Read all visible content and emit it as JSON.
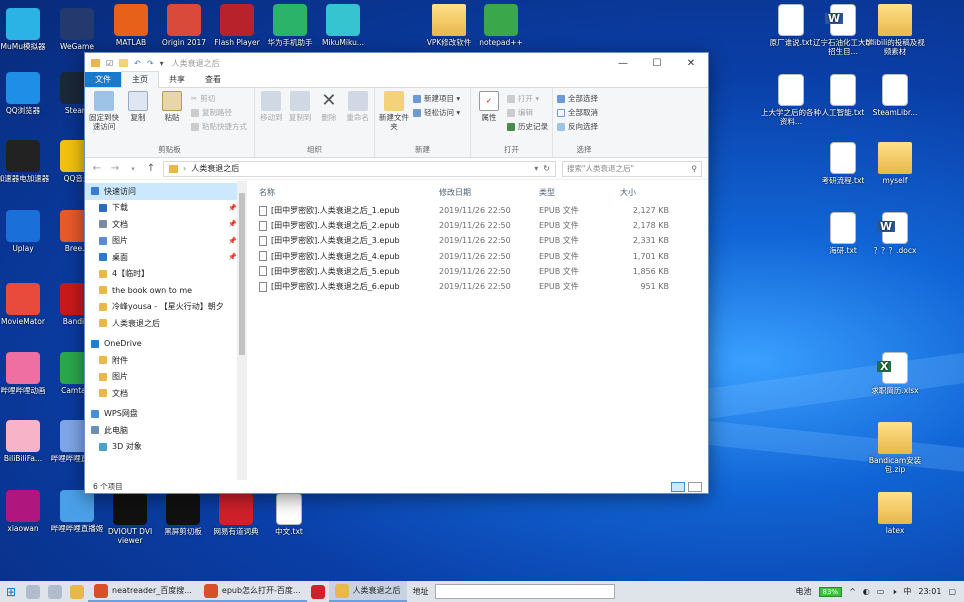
{
  "desktop": {
    "left_col1": [
      "MuMu模拟器",
      "QQ浏览器",
      "加速器电加速器",
      "Uplay",
      "MovieMator",
      "哔哩哔哩动画",
      "BiliBiliFa...",
      "xiaowan"
    ],
    "left_col2": [
      "WeGame",
      "Steam",
      "QQ音乐",
      "Bree...",
      "Bandi...",
      "Camta...",
      "哔哩哔哩直播姬",
      "哔哩哔哩直播姬"
    ],
    "top_row": [
      "MATLAB",
      "Origin 2017",
      "Flash Player",
      "华为手机助手",
      "MikuMiku..."
    ],
    "top_right_files": [
      "VPK修改软件",
      "notepad++"
    ],
    "bottom_row": [
      "DVIOUT DVI viewer",
      "黑屏剪切板",
      "网易有道词典",
      "中文.txt"
    ],
    "right_col": [
      {
        "label": "原厂谁说.txt",
        "kind": "file"
      },
      {
        "label": "辽宁石油化工大学招生目...",
        "kind": "word"
      },
      {
        "label": "bilibili的投稿及视频素材",
        "kind": "folder"
      },
      {
        "label": "上大学之后的各种资料...",
        "kind": "file"
      },
      {
        "label": "人工智能.txt",
        "kind": "file"
      },
      {
        "label": "SteamLibr...",
        "kind": "file"
      },
      {
        "label": "考研流程.txt",
        "kind": "file"
      },
      {
        "label": "myself",
        "kind": "folder"
      },
      {
        "label": "海研.txt",
        "kind": "file"
      },
      {
        "label": "？？？.docx",
        "kind": "word"
      },
      {
        "label": "求职简历.xlsx",
        "kind": "excel"
      },
      {
        "label": "Bandicam安装包.zip",
        "kind": "folder"
      },
      {
        "label": "latex",
        "kind": "folder"
      }
    ]
  },
  "window": {
    "title": "人类衰退之后",
    "controls": {
      "min": "—",
      "max": "☐",
      "close": "✕"
    },
    "tabs": [
      "文件",
      "主页",
      "共享",
      "查看"
    ],
    "ribbon": {
      "clipboard": {
        "name": "剪贴板",
        "pin": "固定到快速访问",
        "copy": "复制",
        "paste": "粘贴",
        "cut": "剪切",
        "copy_path": "复制路径",
        "paste_shortcut": "粘贴快捷方式"
      },
      "organize": {
        "name": "组织",
        "move_to": "移动到",
        "copy_to": "复制到",
        "delete": "删除",
        "rename": "重命名"
      },
      "new": {
        "name": "新建",
        "new_folder": "新建文件夹",
        "new_item": "新建项目 ▾",
        "easy_access": "轻松访问 ▾"
      },
      "open": {
        "name": "打开",
        "properties": "属性",
        "open": "打开 ▾",
        "edit": "编辑",
        "history": "历史记录"
      },
      "select": {
        "name": "选择",
        "select_all": "全部选择",
        "select_none": "全部取消",
        "invert": "反向选择"
      }
    },
    "address": {
      "path": "人类衰退之后",
      "search_placeholder": "搜索\"人类衰退之后\""
    },
    "nav": [
      {
        "label": "快速访问",
        "pinned": false,
        "selected": true
      },
      {
        "label": "下载",
        "pinned": true
      },
      {
        "label": "文档",
        "pinned": true
      },
      {
        "label": "图片",
        "pinned": true
      },
      {
        "label": "桌面",
        "pinned": true
      },
      {
        "label": "4【临时】",
        "pinned": false
      },
      {
        "label": "the book own to me",
        "pinned": false
      },
      {
        "label": "冷峰yousa - 【星火行动】朝夕",
        "pinned": false
      },
      {
        "label": "人类衰退之后",
        "pinned": false
      },
      {
        "label": "OneDrive",
        "pinned": false
      },
      {
        "label": "附件",
        "pinned": false
      },
      {
        "label": "图片",
        "pinned": false
      },
      {
        "label": "文档",
        "pinned": false
      },
      {
        "label": "WPS网盘",
        "pinned": false
      },
      {
        "label": "此电脑",
        "pinned": false
      },
      {
        "label": "3D 对象",
        "pinned": false
      }
    ],
    "columns": {
      "name": "名称",
      "date": "修改日期",
      "type": "类型",
      "size": "大小"
    },
    "files": [
      {
        "name": "[田中罗密欧].人类衰退之后_1.epub",
        "date": "2019/11/26 22:50",
        "type": "EPUB 文件",
        "size": "2,127 KB"
      },
      {
        "name": "[田中罗密欧].人类衰退之后_2.epub",
        "date": "2019/11/26 22:50",
        "type": "EPUB 文件",
        "size": "2,178 KB"
      },
      {
        "name": "[田中罗密欧].人类衰退之后_3.epub",
        "date": "2019/11/26 22:50",
        "type": "EPUB 文件",
        "size": "2,331 KB"
      },
      {
        "name": "[田中罗密欧].人类衰退之后_4.epub",
        "date": "2019/11/26 22:50",
        "type": "EPUB 文件",
        "size": "1,701 KB"
      },
      {
        "name": "[田中罗密欧].人类衰退之后_5.epub",
        "date": "2019/11/26 22:50",
        "type": "EPUB 文件",
        "size": "1,856 KB"
      },
      {
        "name": "[田中罗密欧].人类衰退之后_6.epub",
        "date": "2019/11/26 22:50",
        "type": "EPUB 文件",
        "size": "951 KB"
      }
    ],
    "status": "6 个项目"
  },
  "taskbar": {
    "apps": [
      {
        "label": "neatreader_百度搜...",
        "active": false
      },
      {
        "label": "epub怎么打开-百度...",
        "active": false
      },
      {
        "label": "人类衰退之后",
        "active": true
      }
    ],
    "address_label": "地址",
    "address_value": "",
    "battery_label": "电池",
    "battery": "83%",
    "lang": "中",
    "time": "23:01"
  },
  "colors": {
    "accent": "#1979ca",
    "selection": "#cce8ff",
    "desktop": "#0a3fa8"
  }
}
